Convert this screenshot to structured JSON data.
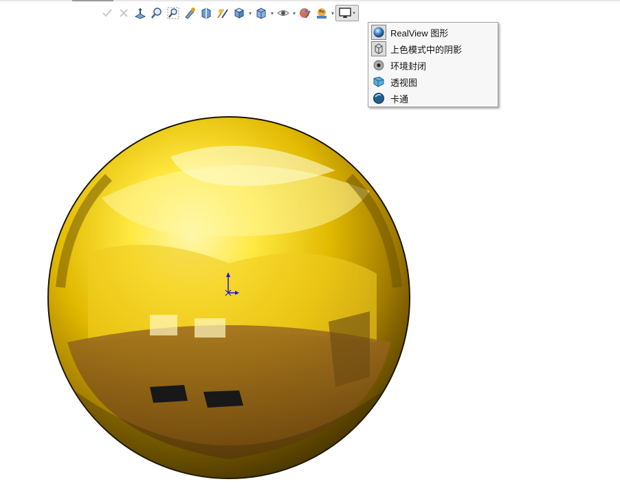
{
  "toolbar": {
    "buttons": [
      {
        "name": "ok-check-icon"
      },
      {
        "name": "cancel-x-icon"
      },
      {
        "name": "view-orientation-icon"
      },
      {
        "name": "zoom-to-fit-icon"
      },
      {
        "name": "zoom-to-area-icon"
      },
      {
        "name": "previous-view-icon"
      },
      {
        "name": "section-view-icon"
      },
      {
        "name": "dynamic-annotation-icon"
      },
      {
        "name": "view-orientation-cube-icon"
      },
      {
        "name": "display-style-icon"
      },
      {
        "name": "hide-show-items-icon"
      },
      {
        "name": "edit-appearance-icon"
      },
      {
        "name": "apply-scene-icon"
      },
      {
        "name": "view-settings-icon"
      }
    ]
  },
  "view_settings_menu": {
    "items": [
      {
        "label": "RealView 图形",
        "icon": "realview-graphics-icon",
        "checked": true
      },
      {
        "label": "上色模式中的阴影",
        "icon": "shadows-in-shaded-mode-icon",
        "checked": true
      },
      {
        "label": "环境封闭",
        "icon": "ambient-occlusion-icon",
        "checked": false
      },
      {
        "label": "透视图",
        "icon": "perspective-icon",
        "checked": false
      },
      {
        "label": "卡通",
        "icon": "cartoon-icon",
        "checked": false
      }
    ]
  },
  "viewport": {
    "model": "gold-chrome-sphere",
    "accent_gold": "#e8c200",
    "triad_color": "#1a1acc"
  }
}
